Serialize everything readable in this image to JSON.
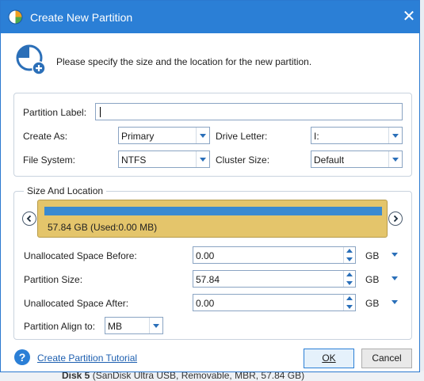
{
  "window": {
    "title": "Create New Partition",
    "close_glyph": "✕"
  },
  "header": {
    "description": "Please specify the size and the location for the new partition."
  },
  "fields": {
    "partition_label": {
      "label": "Partition Label:",
      "value": ""
    },
    "create_as": {
      "label": "Create As:",
      "value": "Primary"
    },
    "drive_letter": {
      "label": "Drive Letter:",
      "value": "I:"
    },
    "file_system": {
      "label": "File System:",
      "value": "NTFS"
    },
    "cluster_size": {
      "label": "Cluster Size:",
      "value": "Default"
    }
  },
  "size_location": {
    "section_title": "Size And Location",
    "partition_bar_text": "57.84 GB (Used:0.00 MB)",
    "usage_fraction": 0.0,
    "unallocated_before": {
      "label": "Unallocated Space Before:",
      "value": "0.00",
      "unit": "GB"
    },
    "partition_size": {
      "label": "Partition Size:",
      "value": "57.84",
      "unit": "GB"
    },
    "unallocated_after": {
      "label": "Unallocated Space After:",
      "value": "0.00",
      "unit": "GB"
    },
    "partition_align": {
      "label": "Partition Align to:",
      "value": "MB"
    }
  },
  "footer": {
    "help_glyph": "?",
    "tutorial_link": "Create Partition Tutorial",
    "ok_label": "OK",
    "cancel_label": "Cancel"
  },
  "background": {
    "disk_label": "Disk 5",
    "disk_desc": " (SanDisk Ultra USB, Removable, MBR, 57.84 GB)"
  },
  "colors": {
    "titlebar": "#2b7fd6",
    "partition_bar": "#e4c56b",
    "partition_fill": "#3a8ad0",
    "link": "#1d5fb0"
  }
}
